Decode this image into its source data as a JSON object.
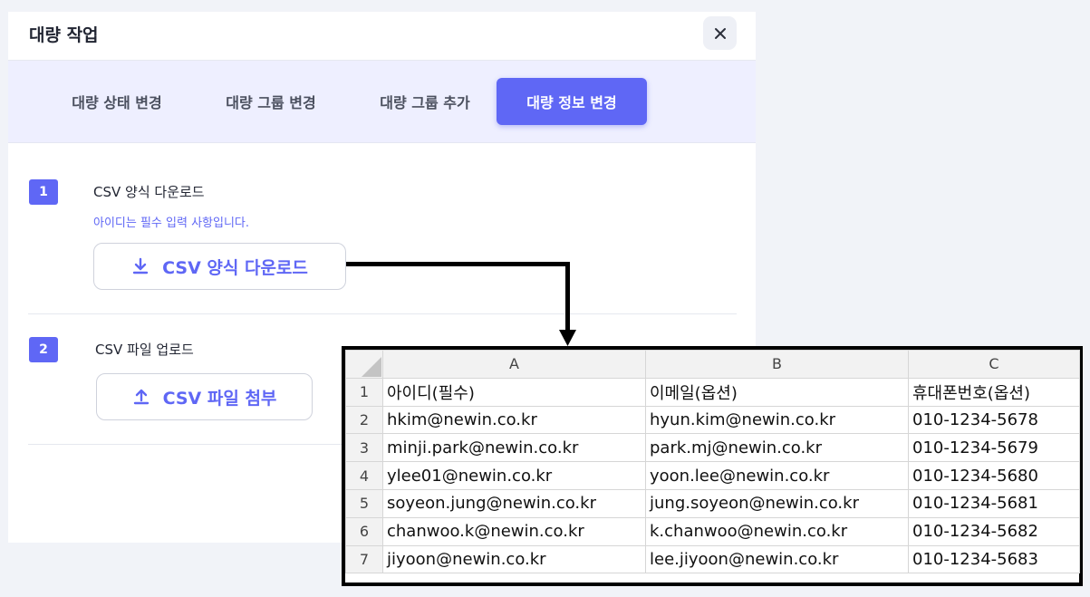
{
  "dialog": {
    "title": "대량 작업",
    "close_icon": "close-icon",
    "tabs": [
      {
        "label": "대량 상태 변경",
        "active": false
      },
      {
        "label": "대량 그룹 변경",
        "active": false
      },
      {
        "label": "대량 그룹 추가",
        "active": false
      },
      {
        "label": "대량 정보 변경",
        "active": true
      }
    ],
    "steps": [
      {
        "number": "1",
        "title": "CSV 양식 다운로드",
        "note": "아이디는 필수 입력 사항입니다.",
        "button_label": "CSV 양식 다운로드",
        "button_icon": "download-icon"
      },
      {
        "number": "2",
        "title": "CSV 파일 업로드",
        "button_label": "CSV 파일 첨부",
        "button_icon": "upload-icon"
      }
    ]
  },
  "spreadsheet": {
    "columns": [
      "A",
      "B",
      "C"
    ],
    "rows": [
      {
        "num": "1",
        "cells": [
          "아이디(필수)",
          "이메일(옵션)",
          "휴대폰번호(옵션)"
        ]
      },
      {
        "num": "2",
        "cells": [
          "hkim@newin.co.kr",
          "hyun.kim@newin.co.kr",
          "010-1234-5678"
        ]
      },
      {
        "num": "3",
        "cells": [
          "minji.park@newin.co.kr",
          "park.mj@newin.co.kr",
          "010-1234-5679"
        ]
      },
      {
        "num": "4",
        "cells": [
          "ylee01@newin.co.kr",
          "yoon.lee@newin.co.kr",
          "010-1234-5680"
        ]
      },
      {
        "num": "5",
        "cells": [
          "soyeon.jung@newin.co.kr",
          "jung.soyeon@newin.co.kr",
          "010-1234-5681"
        ]
      },
      {
        "num": "6",
        "cells": [
          "chanwoo.k@newin.co.kr",
          "k.chanwoo@newin.co.kr",
          "010-1234-5682"
        ]
      },
      {
        "num": "7",
        "cells": [
          "jiyoon@newin.co.kr",
          "lee.jiyoon@newin.co.kr",
          "010-1234-5683"
        ]
      }
    ]
  },
  "colors": {
    "accent": "#5f67f5",
    "tab_bar_bg": "#eeefff",
    "page_bg": "#f1f3f8"
  }
}
